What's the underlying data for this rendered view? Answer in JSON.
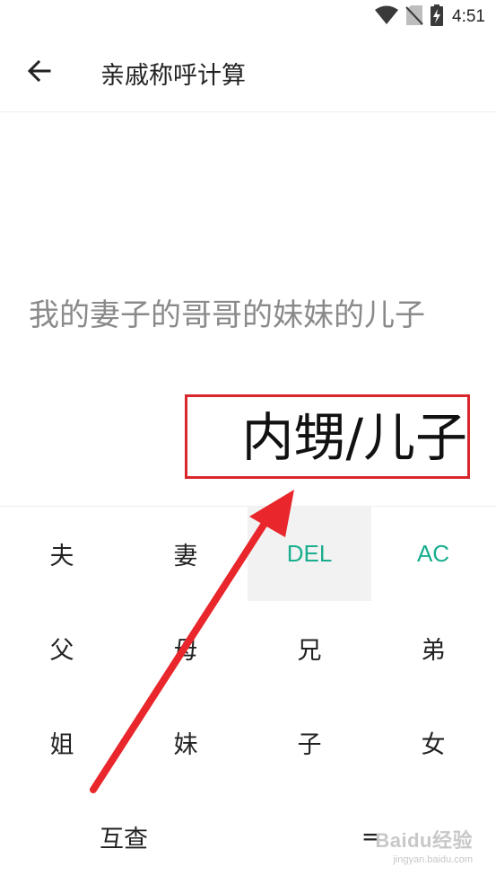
{
  "status_bar": {
    "time": "4:51",
    "icons": [
      "wifi-icon",
      "no-sim-icon",
      "battery-charging-icon"
    ]
  },
  "app_bar": {
    "title": "亲戚称呼计算",
    "back_icon": "arrow-left-icon"
  },
  "expression": "我的妻子的哥哥的妹妹的儿子",
  "result": "内甥/儿子",
  "keypad": {
    "row1": [
      "夫",
      "妻",
      "DEL",
      "AC"
    ],
    "row2": [
      "父",
      "母",
      "兄",
      "弟"
    ],
    "row3": [
      "姐",
      "妹",
      "子",
      "女"
    ],
    "row4": [
      "互查",
      "="
    ]
  },
  "colors": {
    "accent": "#1aae8e",
    "annotation_red": "#d9262c",
    "expression_gray": "#8a8a8a"
  },
  "watermark": {
    "brand": "Baidu经验",
    "sub": "jingyan.baidu.com"
  }
}
